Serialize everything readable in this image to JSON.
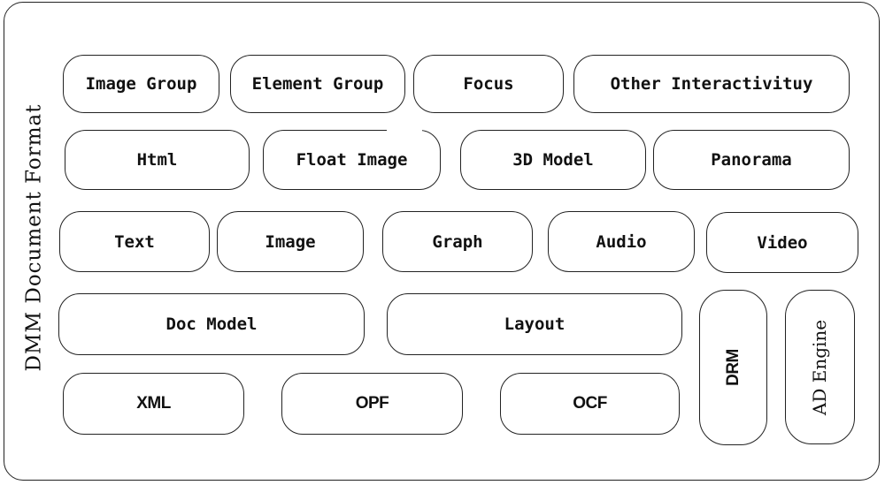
{
  "diagram": {
    "title": "DMM Document Format",
    "rows": [
      {
        "name": "interaction-layer",
        "items": [
          "Image Group",
          "Element Group",
          "Focus",
          "Other Interactivituy"
        ]
      },
      {
        "name": "rich-media-layer",
        "items": [
          "Html",
          "Float Image",
          "3D Model",
          "Panorama"
        ]
      },
      {
        "name": "basic-media-layer",
        "items": [
          "Text",
          "Image",
          "Graph",
          "Audio",
          "Video"
        ]
      },
      {
        "name": "model-layer",
        "items": [
          "Doc Model",
          "Layout"
        ]
      },
      {
        "name": "container-layer",
        "items": [
          "XML",
          "OPF",
          "OCF"
        ]
      }
    ],
    "side_modules": [
      "DRM",
      "AD Engine"
    ]
  }
}
